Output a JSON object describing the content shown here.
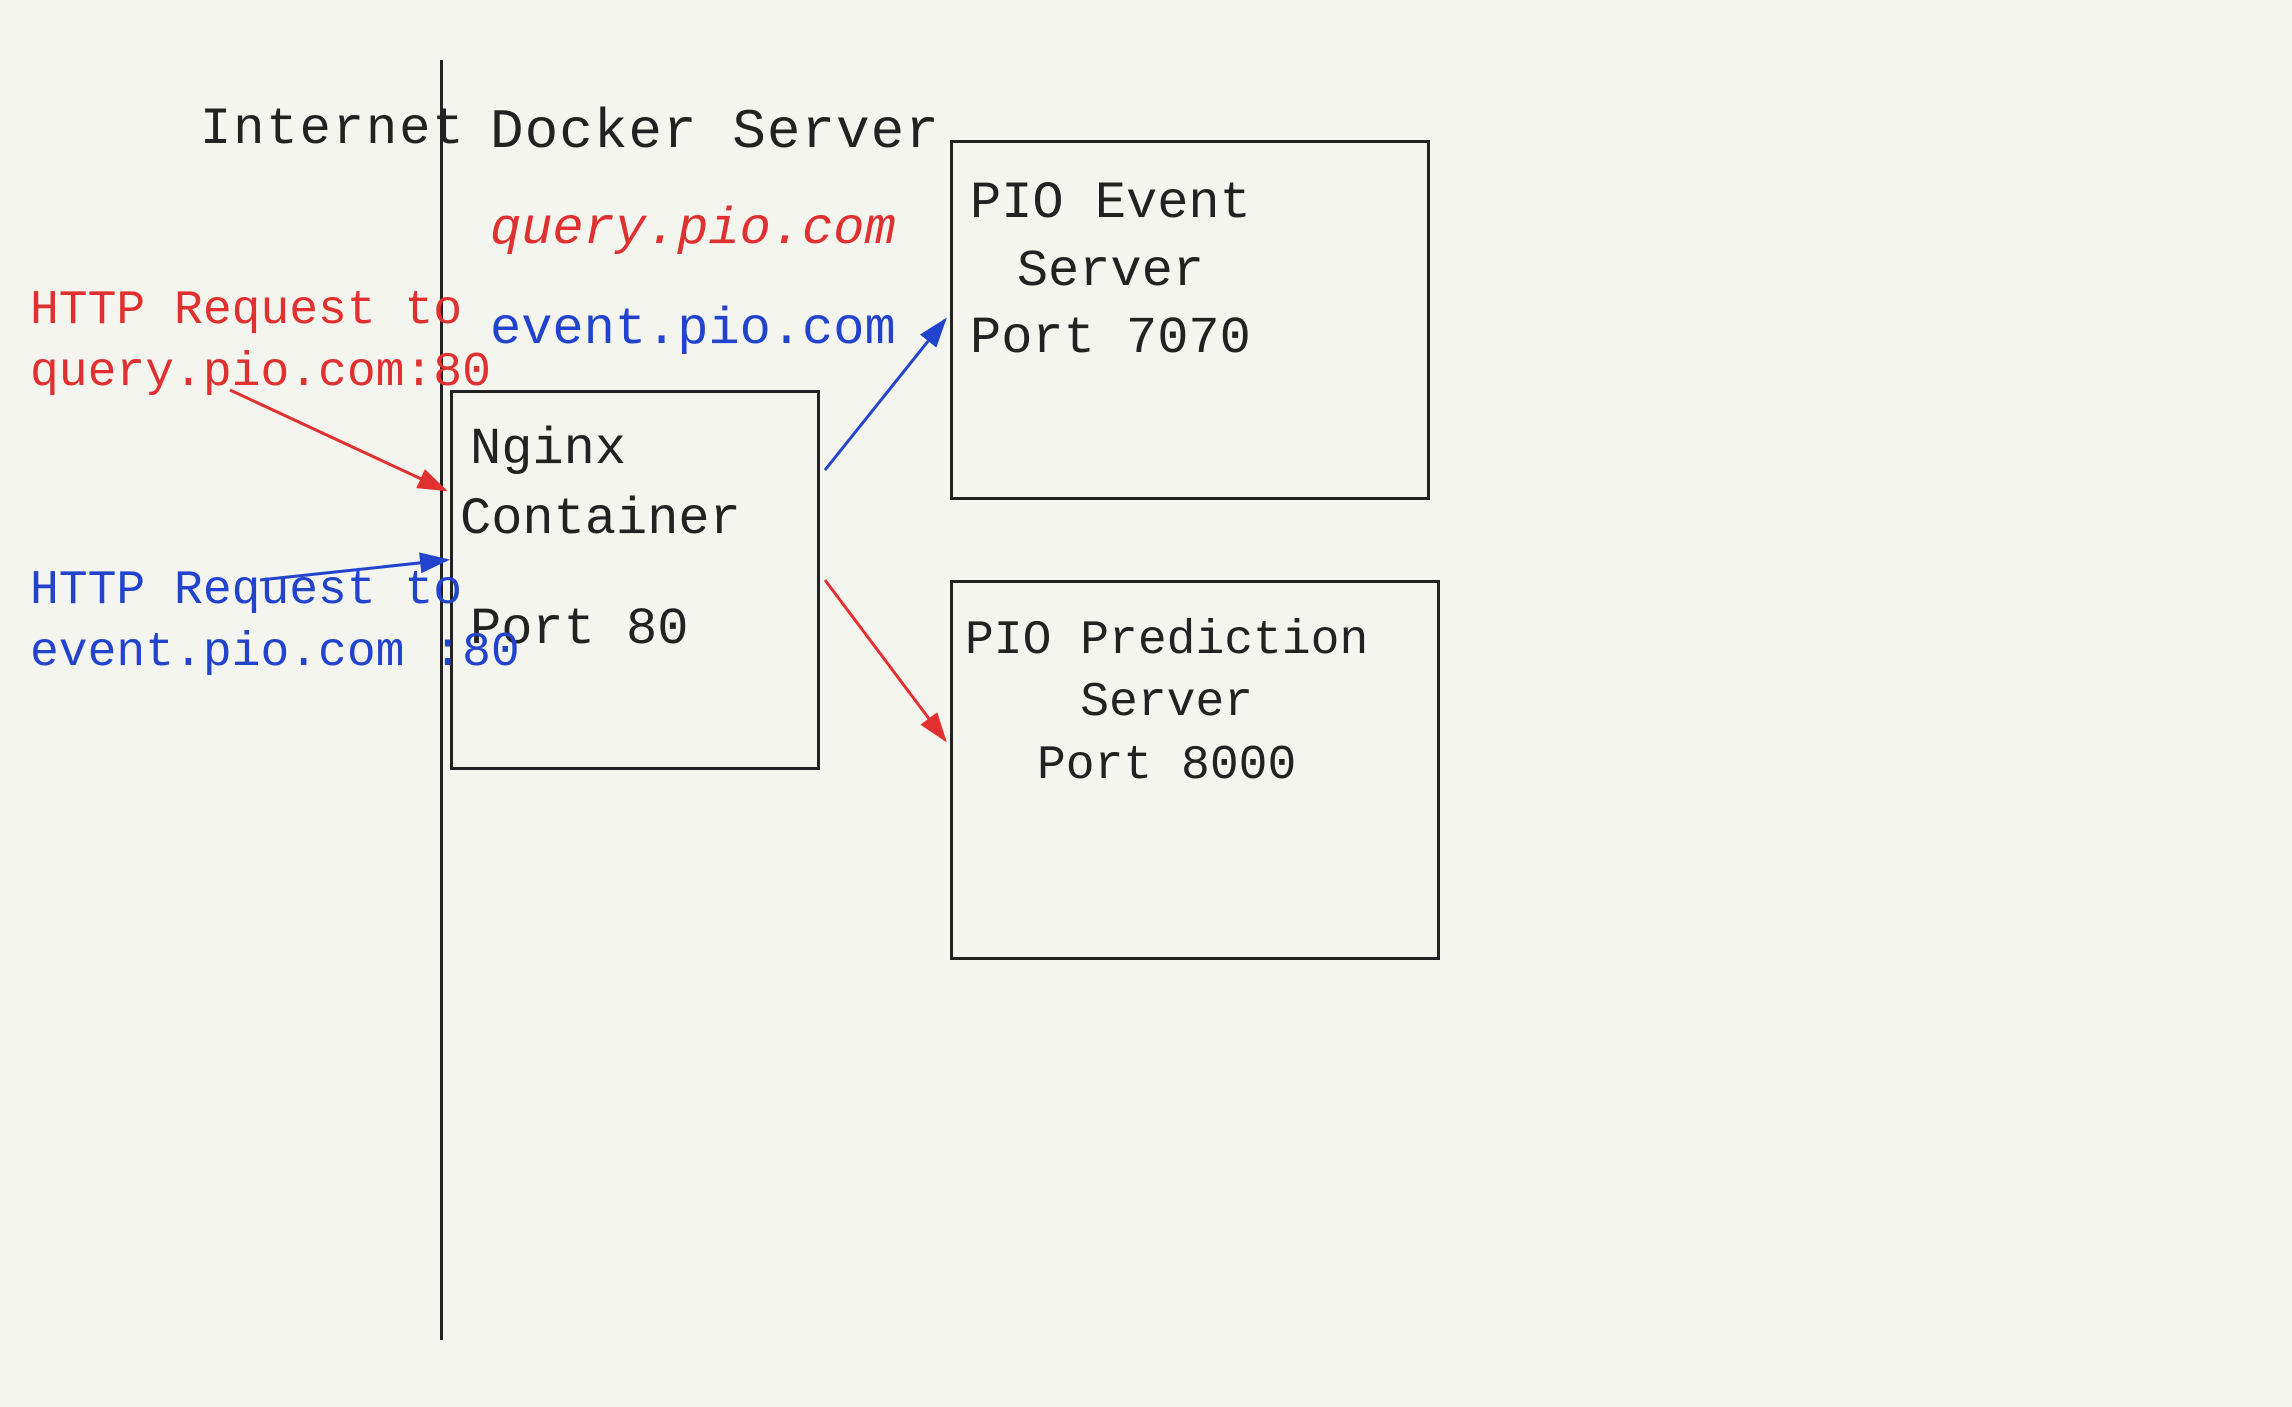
{
  "diagram": {
    "internet_label": "Internet",
    "docker_server_label": "Docker Server",
    "query_domain": "query.pio.com",
    "event_domain": "event.pio.com",
    "nginx_label": "Nginx",
    "container_label": "Container",
    "port80_label": "Port 80",
    "http_request_query_line1": "HTTP Request to",
    "http_request_query_line2": "query.pio.com:80",
    "http_request_event_line1": "HTTP Request to",
    "http_request_event_line2": "event.pio.com :80",
    "pio_event_line1": "PIO Event",
    "pio_event_line2": "Server",
    "pio_event_line3": "Port 7070",
    "pio_pred_line1": "PIO Prediction",
    "pio_pred_line2": "Server",
    "pio_pred_line3": "Port 8000"
  }
}
